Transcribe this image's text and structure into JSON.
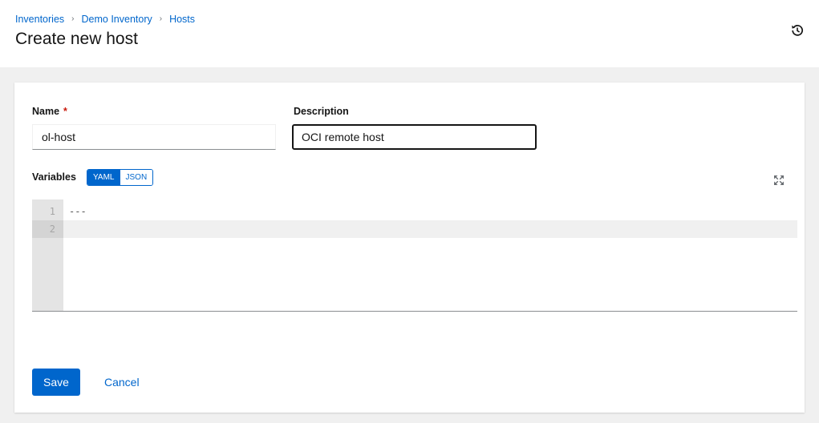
{
  "breadcrumb": {
    "items": [
      "Inventories",
      "Demo Inventory",
      "Hosts"
    ],
    "separator": "›"
  },
  "header": {
    "title": "Create new host",
    "history_icon": "history-icon"
  },
  "form": {
    "name": {
      "label": "Name",
      "required_mark": "*",
      "value": "ol-host"
    },
    "description": {
      "label": "Description",
      "value": "OCI remote host"
    },
    "variables": {
      "label": "Variables",
      "modes": [
        "YAML",
        "JSON"
      ],
      "active_mode": "YAML",
      "expand_icon": "expand-icon",
      "lines": [
        {
          "num": "1",
          "text": "---"
        },
        {
          "num": "2",
          "text": ""
        }
      ]
    }
  },
  "actions": {
    "save_label": "Save",
    "cancel_label": "Cancel"
  },
  "colors": {
    "primary": "#0066cc",
    "required": "#c9190b",
    "background": "#f0f0f0"
  }
}
